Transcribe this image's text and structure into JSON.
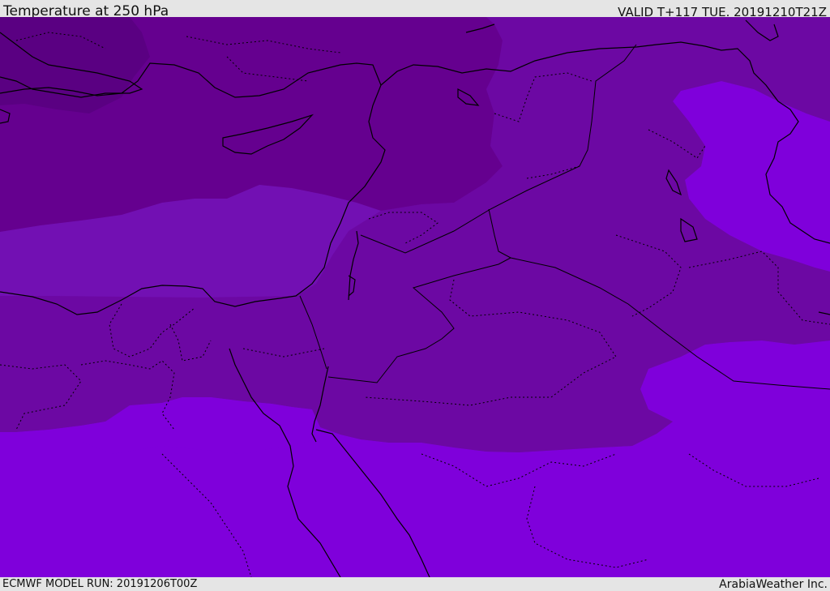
{
  "header": {
    "title": "Temperature at 250 hPa",
    "valid": "VALID T+117 TUE. 20191210T21Z"
  },
  "footer": {
    "model_run": "ECMWF MODEL RUN: 20191206T00Z",
    "credit": "ArabiaWeather Inc."
  },
  "map": {
    "variable": "temperature",
    "level": "250 hPa",
    "colors": {
      "coldest": "#65008f",
      "colder": "#6c08a3",
      "cold": "#7210b3",
      "warm": "#7f00db",
      "border_line": "#000000"
    }
  }
}
